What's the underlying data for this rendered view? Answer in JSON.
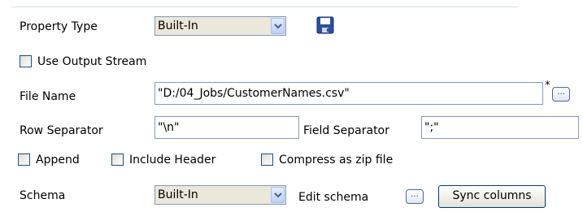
{
  "property": {
    "label": "Property Type",
    "value": "Built-In"
  },
  "save_icon": "floppy-save-icon",
  "use_output_stream": {
    "label": "Use Output Stream",
    "checked": false
  },
  "file": {
    "label": "File Name",
    "value": "\"D:/04_Jobs/CustomerNames.csv\"",
    "required_mark": "*",
    "browse_label": "..."
  },
  "row_separator": {
    "label": "Row Separator",
    "value": "\"\\n\""
  },
  "field_separator": {
    "label": "Field Separator",
    "value": "\";\""
  },
  "options": {
    "append": {
      "label": "Append",
      "checked": false
    },
    "include_header": {
      "label": "Include Header",
      "checked": false
    },
    "compress": {
      "label": "Compress as zip file",
      "checked": false
    }
  },
  "schema": {
    "label": "Schema",
    "value": "Built-In",
    "edit_label": "Edit schema",
    "edit_button_label": "...",
    "sync_label": "Sync columns"
  },
  "colors": {
    "border": "#7f9db9",
    "combo_bg": "#ebe7da",
    "accent": "#2b4f9a"
  }
}
